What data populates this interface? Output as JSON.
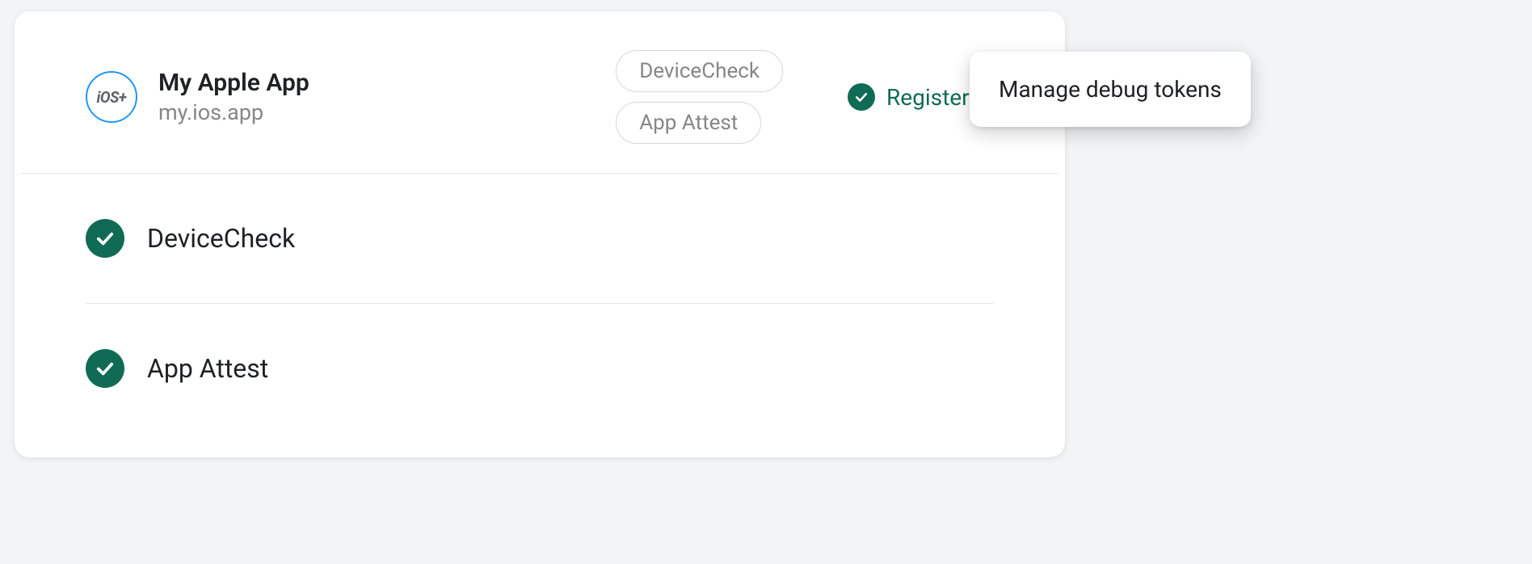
{
  "app": {
    "icon_label": "iOS+",
    "name": "My Apple App",
    "bundle": "my.ios.app"
  },
  "chips": [
    "DeviceCheck",
    "App Attest"
  ],
  "status": {
    "label": "Registered"
  },
  "providers": [
    "DeviceCheck",
    "App Attest"
  ],
  "popover": {
    "label": "Manage debug tokens"
  }
}
